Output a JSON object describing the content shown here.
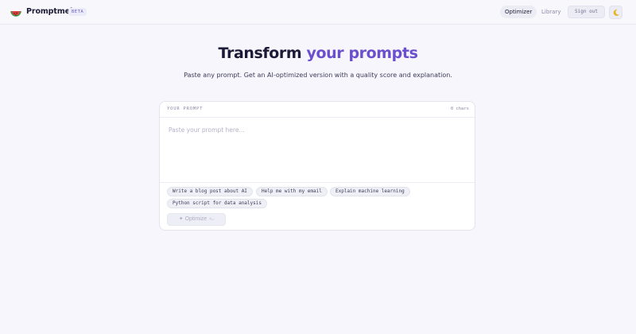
{
  "header": {
    "brand": "Promptmelo",
    "badge": "BETA",
    "nav": [
      {
        "label": "Optimizer",
        "active": true
      },
      {
        "label": "Library",
        "active": false
      }
    ],
    "sign_out": "Sign out",
    "logo_icon": "watermelon-icon",
    "theme_icon": "moon-icon"
  },
  "hero": {
    "title_main": "Transform ",
    "title_accent": "your prompts",
    "subtitle": "Paste any prompt. Get an AI-optimized version with a quality score and explanation."
  },
  "editor": {
    "label": "YOUR PROMPT",
    "char_count": "0 chars",
    "value": "",
    "placeholder": "Paste your prompt here...",
    "suggestions": [
      "Write a blog post about AI",
      "Help me with my email",
      "Explain machine learning",
      "Python script for data analysis"
    ],
    "optimize_label": "✦ Optimize",
    "optimize_shortcut": "⌘↵"
  },
  "colors": {
    "accent": "#6b4fcf",
    "background": "#f6f6fc",
    "text": "#1c1a36"
  }
}
